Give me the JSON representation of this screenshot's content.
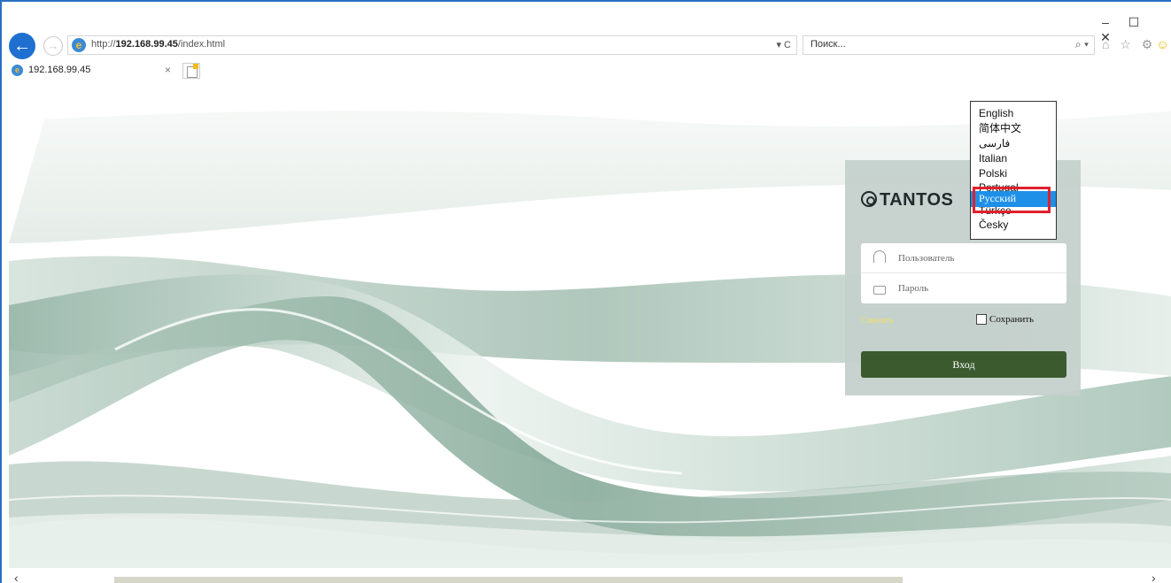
{
  "browser": {
    "url_prefix": "http://",
    "url_host": "192.168.99.45",
    "url_path": "/index.html",
    "url_controls": "▾ C",
    "search_placeholder": "Поиск...",
    "search_icon_glyph": "⌕ ▾",
    "tool_icons": "⌂ ☆ ⚙",
    "smiley_glyph": "☺",
    "win_min": "–",
    "win_max": "☐",
    "win_close": "✕",
    "back_glyph": "←",
    "forward_glyph": "→"
  },
  "tab": {
    "label": "192.168.99.45",
    "close": "×"
  },
  "login": {
    "logo_text": "TANTOS",
    "username_placeholder": "Пользователь",
    "password_placeholder": "Пароль",
    "forgot_label": "Сменить",
    "remember_label": "Сохранить",
    "login_button": "Вход"
  },
  "language_dropdown": {
    "options": [
      "English",
      "简体中文",
      "فارسی",
      "Italian",
      "Polski",
      "Portugal",
      "Русский",
      "Türkçe",
      "Česky"
    ],
    "selected": "Русский"
  },
  "scrollbar": {
    "left_arrow": "‹",
    "right_arrow": "›"
  },
  "colors": {
    "accent_blue": "#1f6fd1",
    "login_button": "#3b5a2e",
    "selection": "#1e90e8",
    "highlight_box": "#e0202d"
  }
}
